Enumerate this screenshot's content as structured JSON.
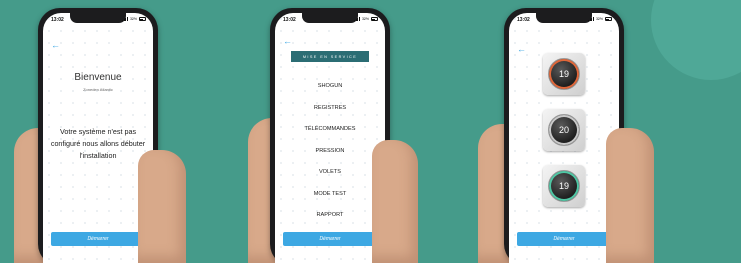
{
  "colors": {
    "background": "#459b8a",
    "accent": "#3da8e3",
    "banner": "#2b6d74"
  },
  "phones": [
    {
      "status": {
        "time": "13:02",
        "battery": "32%"
      },
      "back_icon": "arrow-left-icon",
      "title": "Bienvenue",
      "subtitle": "Zoneden Atlantic",
      "message": "Votre système n'est pas configuré nous allons débuter l'installation",
      "button": "Démarrer"
    },
    {
      "status": {
        "time": "13:02",
        "battery": "32%"
      },
      "back_icon": "arrow-left-icon",
      "banner": "MISE EN SERVICE",
      "menu": [
        "SHOGUN",
        "REGISTRES",
        "TÉLÉCOMMANDES",
        "PRESSION",
        "VOLETS",
        "MODE TEST",
        "RAPPORT"
      ],
      "button": "Démarrer"
    },
    {
      "status": {
        "time": "13:02",
        "battery": "32%"
      },
      "back_icon": "arrow-left-icon",
      "thermostats": [
        {
          "value": "19",
          "accent": "#e0673a"
        },
        {
          "value": "20",
          "accent": "#c9c9c9"
        },
        {
          "value": "19",
          "accent": "#4fc7a4"
        }
      ],
      "button": "Démarrer"
    }
  ]
}
